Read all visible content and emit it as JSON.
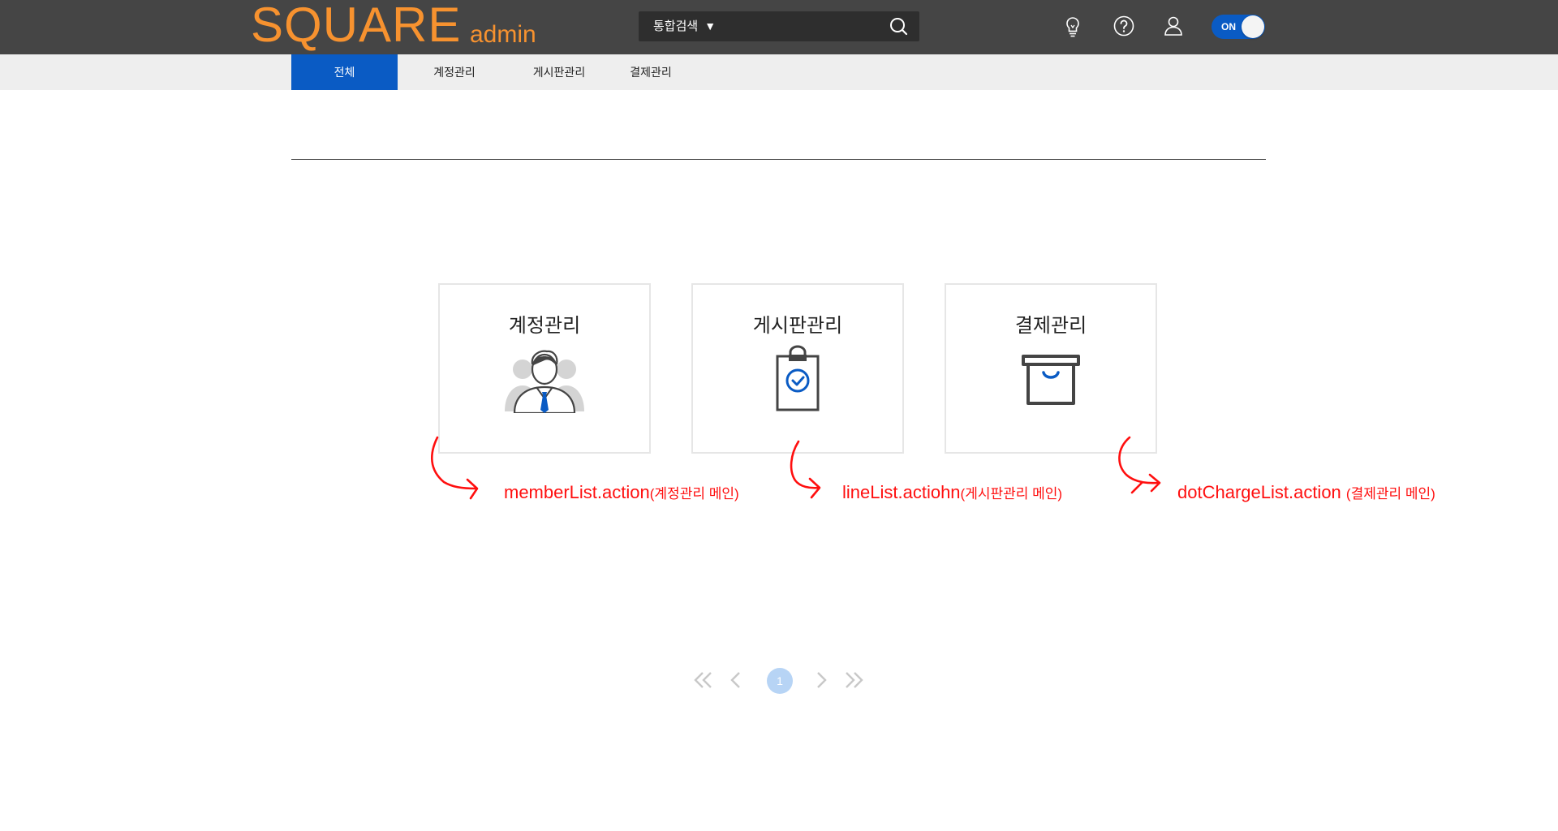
{
  "header": {
    "logo_main": "SQUARE",
    "logo_sub": "admin",
    "search_scope": "통합검색",
    "search_placeholder": "",
    "toggle_label": "ON",
    "icons": [
      "lightbulb-icon",
      "help-icon",
      "user-icon",
      "search-icon"
    ]
  },
  "nav": {
    "tabs": [
      {
        "label": "전체",
        "active": true
      },
      {
        "label": "계정관리",
        "active": false
      },
      {
        "label": "게시판관리",
        "active": false
      },
      {
        "label": "결제관리",
        "active": false
      }
    ]
  },
  "cards": [
    {
      "title": "계정관리",
      "icon": "account-manager-icon"
    },
    {
      "title": "게시판관리",
      "icon": "clipboard-check-icon"
    },
    {
      "title": "결제관리",
      "icon": "payment-box-icon"
    }
  ],
  "annotations": [
    {
      "main": "memberList.action",
      "sub": "(계정관리 메인)"
    },
    {
      "main": "lineList.actiohn",
      "sub": "(게시판관리 메인)"
    },
    {
      "main": "dotChargeList.action ",
      "sub": "(결제관리 메인)"
    }
  ],
  "pagination": {
    "current_page": "1",
    "icons": [
      "first-page-icon",
      "prev-page-icon",
      "next-page-icon",
      "last-page-icon"
    ]
  },
  "colors": {
    "header_bg": "#454545",
    "logo": "#f7922f",
    "accent": "#0a5bc4",
    "annotation": "#ff0f0f",
    "page_active": "#b7d4f5"
  }
}
